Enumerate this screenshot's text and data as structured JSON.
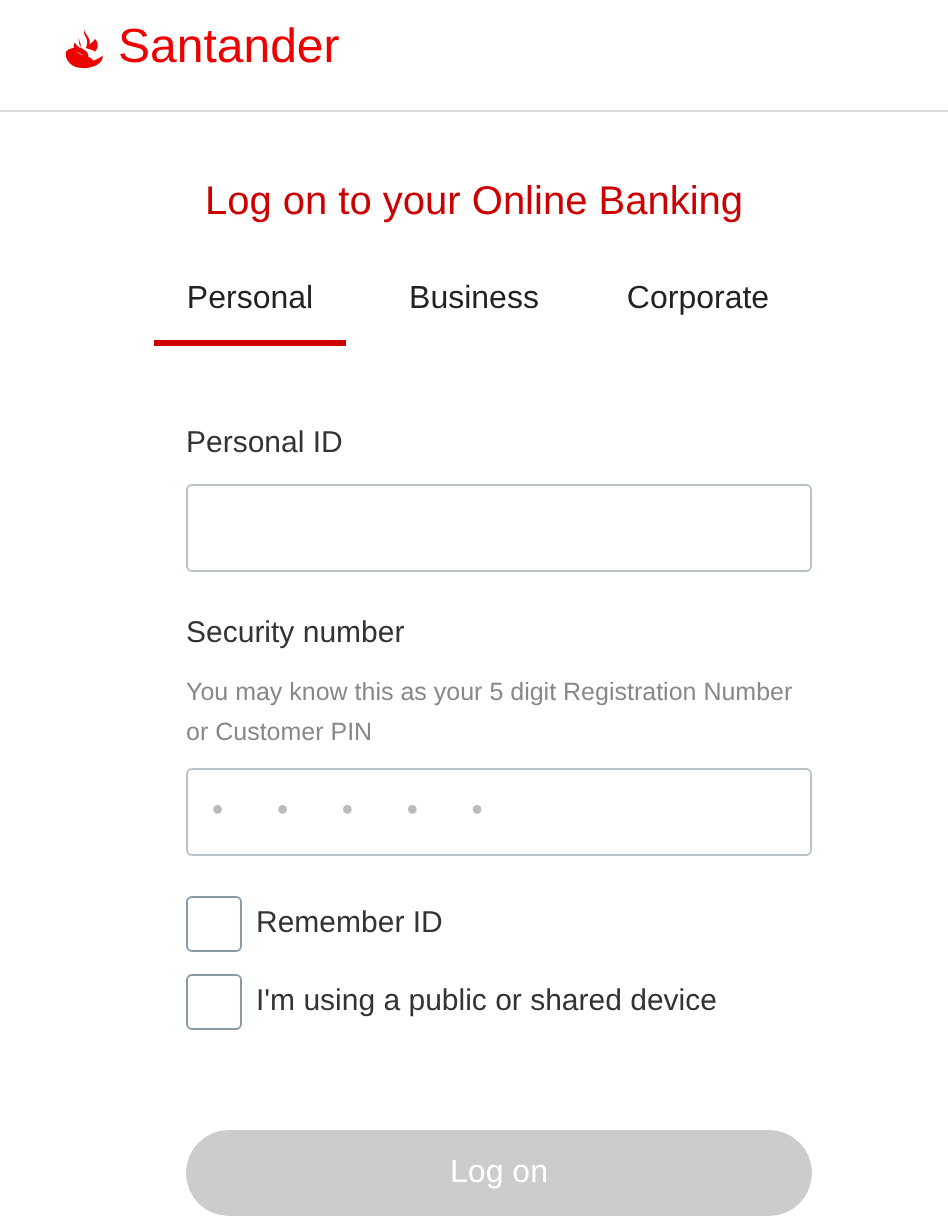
{
  "header": {
    "brand": "Santander"
  },
  "title": "Log on to your Online Banking",
  "tabs": [
    {
      "label": "Personal",
      "selected": true
    },
    {
      "label": "Business",
      "selected": false
    },
    {
      "label": "Corporate",
      "selected": false
    }
  ],
  "fields": [
    {
      "label": "Personal ID"
    },
    {
      "label": "Security number",
      "hint": "You may know this as your 5 digit Registration Number or Customer PIN",
      "placeholder": "• • • • •"
    }
  ],
  "checkboxes": [
    {
      "label": "Remember ID",
      "checked": false
    },
    {
      "label": "I'm using a public or shared device",
      "checked": false
    }
  ],
  "button": {
    "label": "Log on",
    "disabled": true
  }
}
